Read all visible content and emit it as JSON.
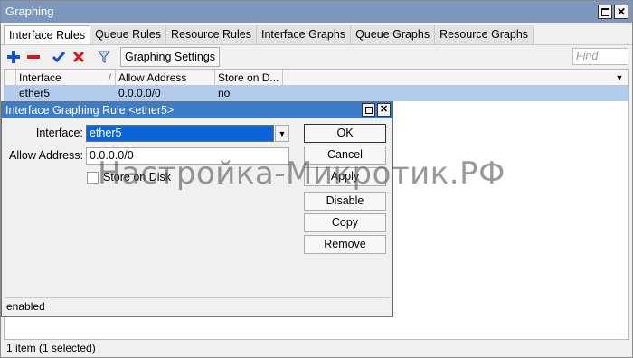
{
  "window": {
    "title": "Graphing"
  },
  "tabs": [
    "Interface Rules",
    "Queue Rules",
    "Resource Rules",
    "Interface Graphs",
    "Queue Graphs",
    "Resource Graphs"
  ],
  "toolbar": {
    "graphing_settings": "Graphing Settings",
    "find_placeholder": "Find"
  },
  "table": {
    "headers": [
      "Interface",
      "Allow Address",
      "Store on D..."
    ],
    "rows": [
      {
        "interface": "ether5",
        "allow_address": "0.0.0.0/0",
        "store_on_disk": "no"
      }
    ]
  },
  "status": "1 item (1 selected)",
  "dialog": {
    "title": "Interface Graphing Rule <ether5>",
    "interface_label": "Interface:",
    "interface_value": "ether5",
    "allow_address_label": "Allow Address:",
    "allow_address_value": "0.0.0.0/0",
    "store_on_disk_label": "Store on Disk",
    "buttons": {
      "ok": "OK",
      "cancel": "Cancel",
      "apply": "Apply",
      "disable": "Disable",
      "copy": "Copy",
      "remove": "Remove"
    },
    "status": "enabled"
  },
  "watermark": "Настройка-Микротик.РФ",
  "colors": {
    "titlebar": "#7d98bc",
    "dialog_titlebar": "#3d7cc9",
    "selected_row": "#b3cbec",
    "selected_field": "#0a64d7"
  }
}
